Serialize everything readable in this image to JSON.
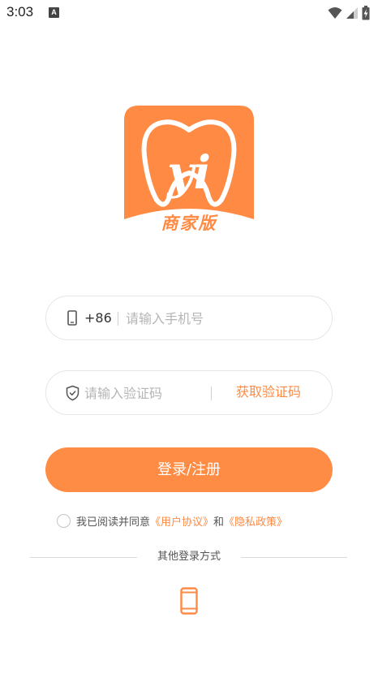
{
  "status_bar": {
    "time": "3:03",
    "keyboard_badge": "A",
    "icons": [
      "wifi-icon",
      "cell-signal-icon",
      "battery-icon"
    ]
  },
  "logo": {
    "letters": "yi",
    "caption": "商家版",
    "color": "#ff8a44"
  },
  "phone_field": {
    "country_code": "+86",
    "placeholder": "请输入手机号",
    "value": ""
  },
  "code_field": {
    "placeholder": "请输入验证码",
    "value": "",
    "get_code_label": "获取验证码"
  },
  "login_button": {
    "label": "登录/注册",
    "color": "#ff8c45"
  },
  "agreement": {
    "checked": false,
    "prefix": "我已阅读并同意",
    "user_agreement": "《用户协议》",
    "conjunction": "和",
    "privacy_policy": "《隐私政策》"
  },
  "other_login": {
    "label": "其他登录方式",
    "methods": [
      "phone-icon"
    ]
  },
  "colors": {
    "accent": "#ff8a44",
    "placeholder": "#b5b5b5",
    "border": "#e6e6e6"
  }
}
